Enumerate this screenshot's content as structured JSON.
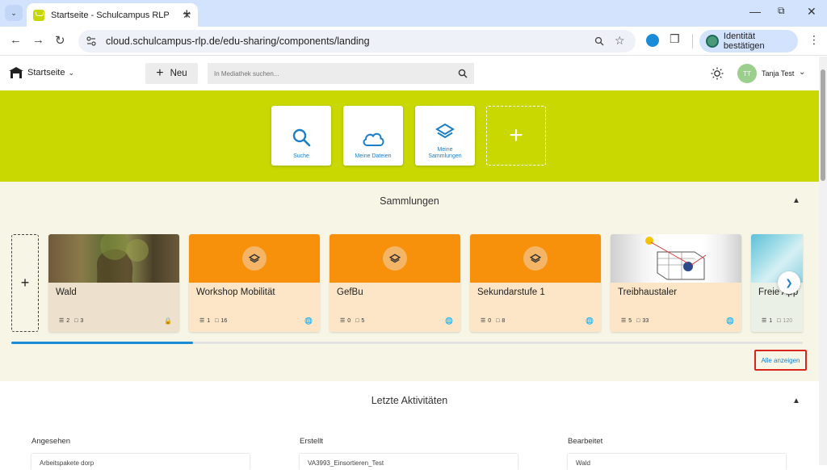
{
  "browser": {
    "tab_title": "Startseite - Schulcampus RLP",
    "url": "cloud.schulcampus-rlp.de/edu-sharing/components/landing",
    "identity_label": "Identität bestätigen"
  },
  "header": {
    "home_label": "Startseite",
    "new_label": "Neu",
    "search_placeholder": "In Mediathek suchen...",
    "user_initials": "TT",
    "user_name": "Tanja Test"
  },
  "hero": {
    "tiles": [
      {
        "label": "Suche",
        "icon": "search-icon"
      },
      {
        "label": "Meine Dateien",
        "icon": "cloud-icon"
      },
      {
        "label": "Meine\nSammlungen",
        "icon": "layers-icon"
      }
    ]
  },
  "collections": {
    "title": "Sammlungen",
    "cards": [
      {
        "title": "Wald",
        "sub": "2",
        "files": "3",
        "scope": "lock-icon"
      },
      {
        "title": "Workshop Mobilität",
        "sub": "1",
        "files": "16",
        "scope": "globe-icon"
      },
      {
        "title": "GefBu",
        "sub": "0",
        "files": "5",
        "scope": "globe-icon"
      },
      {
        "title": "Sekundarstufe 1",
        "sub": "0",
        "files": "8",
        "scope": "globe-icon"
      },
      {
        "title": "Treibhaustaler",
        "sub": "5",
        "files": "33",
        "scope": "globe-icon"
      },
      {
        "title": "Freie App",
        "sub": "1",
        "files": "120",
        "scope": "globe-icon"
      }
    ],
    "scroll_fraction": 0.23,
    "show_all_label": "Alle anzeigen"
  },
  "activities": {
    "title": "Letzte Aktivitäten",
    "columns": [
      {
        "heading": "Angesehen",
        "first_item": "Arbeitspakete dorp"
      },
      {
        "heading": "Erstellt",
        "first_item": "VA3993_Einsortieren_Test"
      },
      {
        "heading": "Bearbeitet",
        "first_item": "Wald"
      }
    ]
  },
  "colors": {
    "hero_bg": "#c8d800",
    "accent_blue": "#1a7ec8",
    "collection_orange": "#f7900a",
    "card_body": "#fde6c7",
    "highlight_red": "#d9261c"
  }
}
